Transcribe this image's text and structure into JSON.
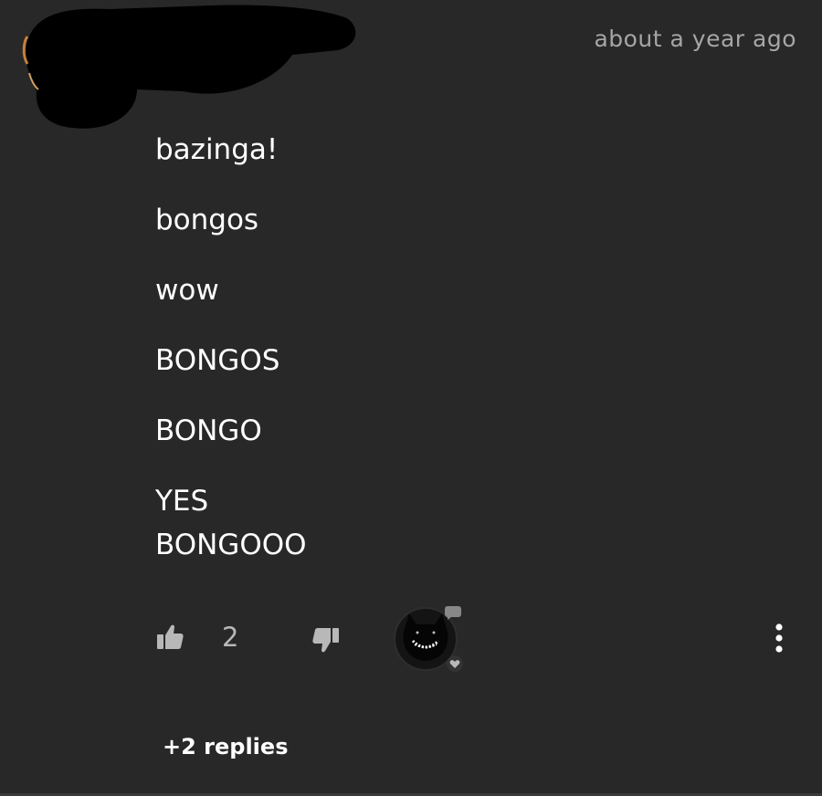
{
  "comment": {
    "timestamp": "about a year ago",
    "lines": [
      "bazinga!",
      "bongos",
      "wow",
      "BONGOS",
      "BONGO",
      "YES",
      "BONGOOO"
    ]
  },
  "actions": {
    "like_icon": "thumbs-up-icon",
    "like_count": "2",
    "dislike_icon": "thumbs-down-icon",
    "reactor_icon": "creator-heart-avatar",
    "more_icon": "vertical-ellipsis-icon"
  },
  "replies": {
    "label": "+2 replies"
  },
  "colors": {
    "background": "#282828",
    "text": "#ffffff",
    "muted": "#a6a6a6",
    "icon": "#b8b8b8"
  }
}
